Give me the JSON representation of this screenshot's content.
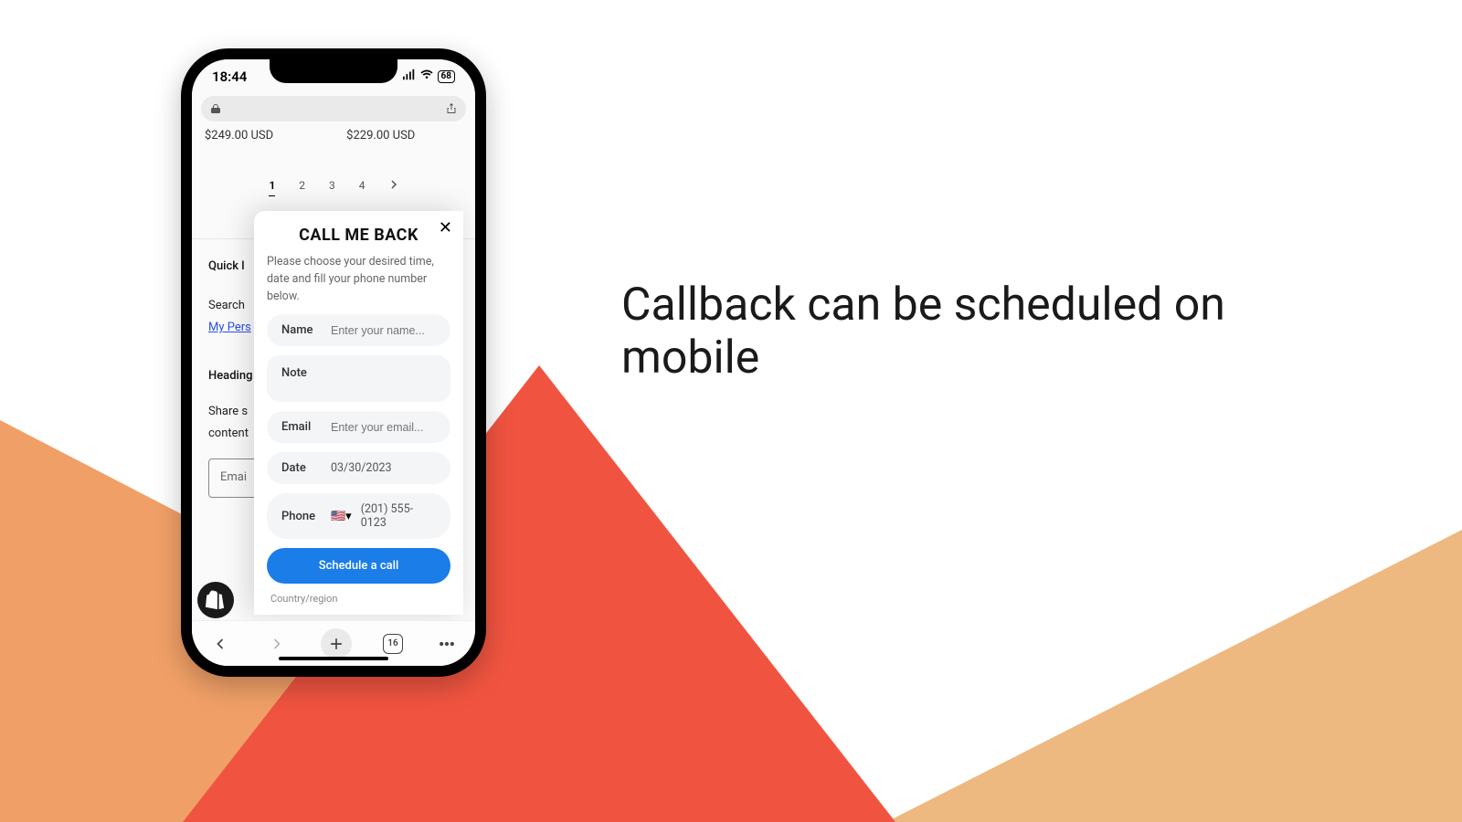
{
  "headline": "Callback can be scheduled on mobile",
  "status": {
    "time": "18:44",
    "battery": "68"
  },
  "prices": {
    "left": "$249.00 USD",
    "right": "$229.00 USD"
  },
  "pagination": {
    "p1": "1",
    "p2": "2",
    "p3": "3",
    "p4": "4"
  },
  "sidebar": {
    "quick_heading": "Quick l",
    "search": "Search",
    "my_pers": "My Pers",
    "heading": "Heading",
    "share": "Share s",
    "content": "content",
    "email": "Emai"
  },
  "modal": {
    "title": "CALL ME BACK",
    "desc": "Please choose your desired time, date and fill your phone number below.",
    "name_label": "Name",
    "name_placeholder": "Enter your name...",
    "note_label": "Note",
    "email_label": "Email",
    "email_placeholder": "Enter your email...",
    "date_label": "Date",
    "date_value": "03/30/2023",
    "phone_label": "Phone",
    "phone_value": "(201) 555-0123",
    "button": "Schedule a call",
    "country_label": "Country/region"
  },
  "bottom_nav": {
    "tabs_count": "16"
  }
}
